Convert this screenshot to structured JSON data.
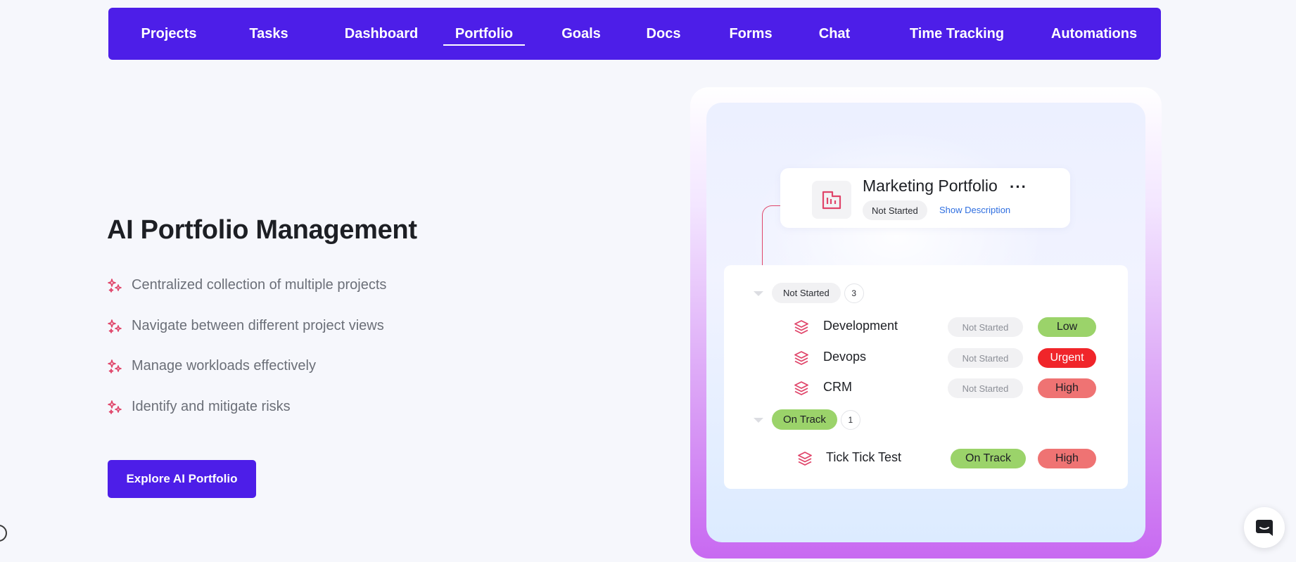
{
  "nav": {
    "tabs": [
      {
        "label": "Projects",
        "active": false
      },
      {
        "label": "Tasks",
        "active": false
      },
      {
        "label": "Dashboard",
        "active": false
      },
      {
        "label": "Portfolio",
        "active": true
      },
      {
        "label": "Goals",
        "active": false
      },
      {
        "label": "Docs",
        "active": false
      },
      {
        "label": "Forms",
        "active": false
      },
      {
        "label": "Chat",
        "active": false
      },
      {
        "label": "Time Tracking",
        "active": false
      },
      {
        "label": "Automations",
        "active": false
      }
    ]
  },
  "hero": {
    "title": "AI Portfolio Management",
    "features": [
      "Centralized collection of multiple projects",
      "Navigate between different project views",
      "Manage workloads effectively",
      "Identify and mitigate risks"
    ],
    "cta_label": "Explore AI Portfolio"
  },
  "portfolio": {
    "title": "Marketing Portfolio",
    "more": "···",
    "status": "Not Started",
    "show_description": "Show Description",
    "groups": [
      {
        "label": "Not Started",
        "count": "3",
        "items": [
          {
            "name": "Development",
            "status": "Not Started",
            "priority": "Low"
          },
          {
            "name": "Devops",
            "status": "Not Started",
            "priority": "Urgent"
          },
          {
            "name": "CRM",
            "status": "Not Started",
            "priority": "High"
          }
        ]
      },
      {
        "label": "On Track",
        "count": "1",
        "items": [
          {
            "name": "Tick Tick Test",
            "status": "On Track",
            "priority": "High"
          }
        ]
      }
    ]
  },
  "colors": {
    "brand": "#4d1ee8",
    "pill_grey": "#f1f1f3",
    "on_track": "#9bd36a",
    "low": "#9bd36a",
    "urgent": "#f0252a",
    "high": "#ef7373",
    "accent_red": "#e0456a"
  },
  "icons": {
    "feature": "sparkle-icon",
    "portfolio": "portfolio-building-icon",
    "project": "layers-icon",
    "chat": "chat-bubble-icon"
  }
}
